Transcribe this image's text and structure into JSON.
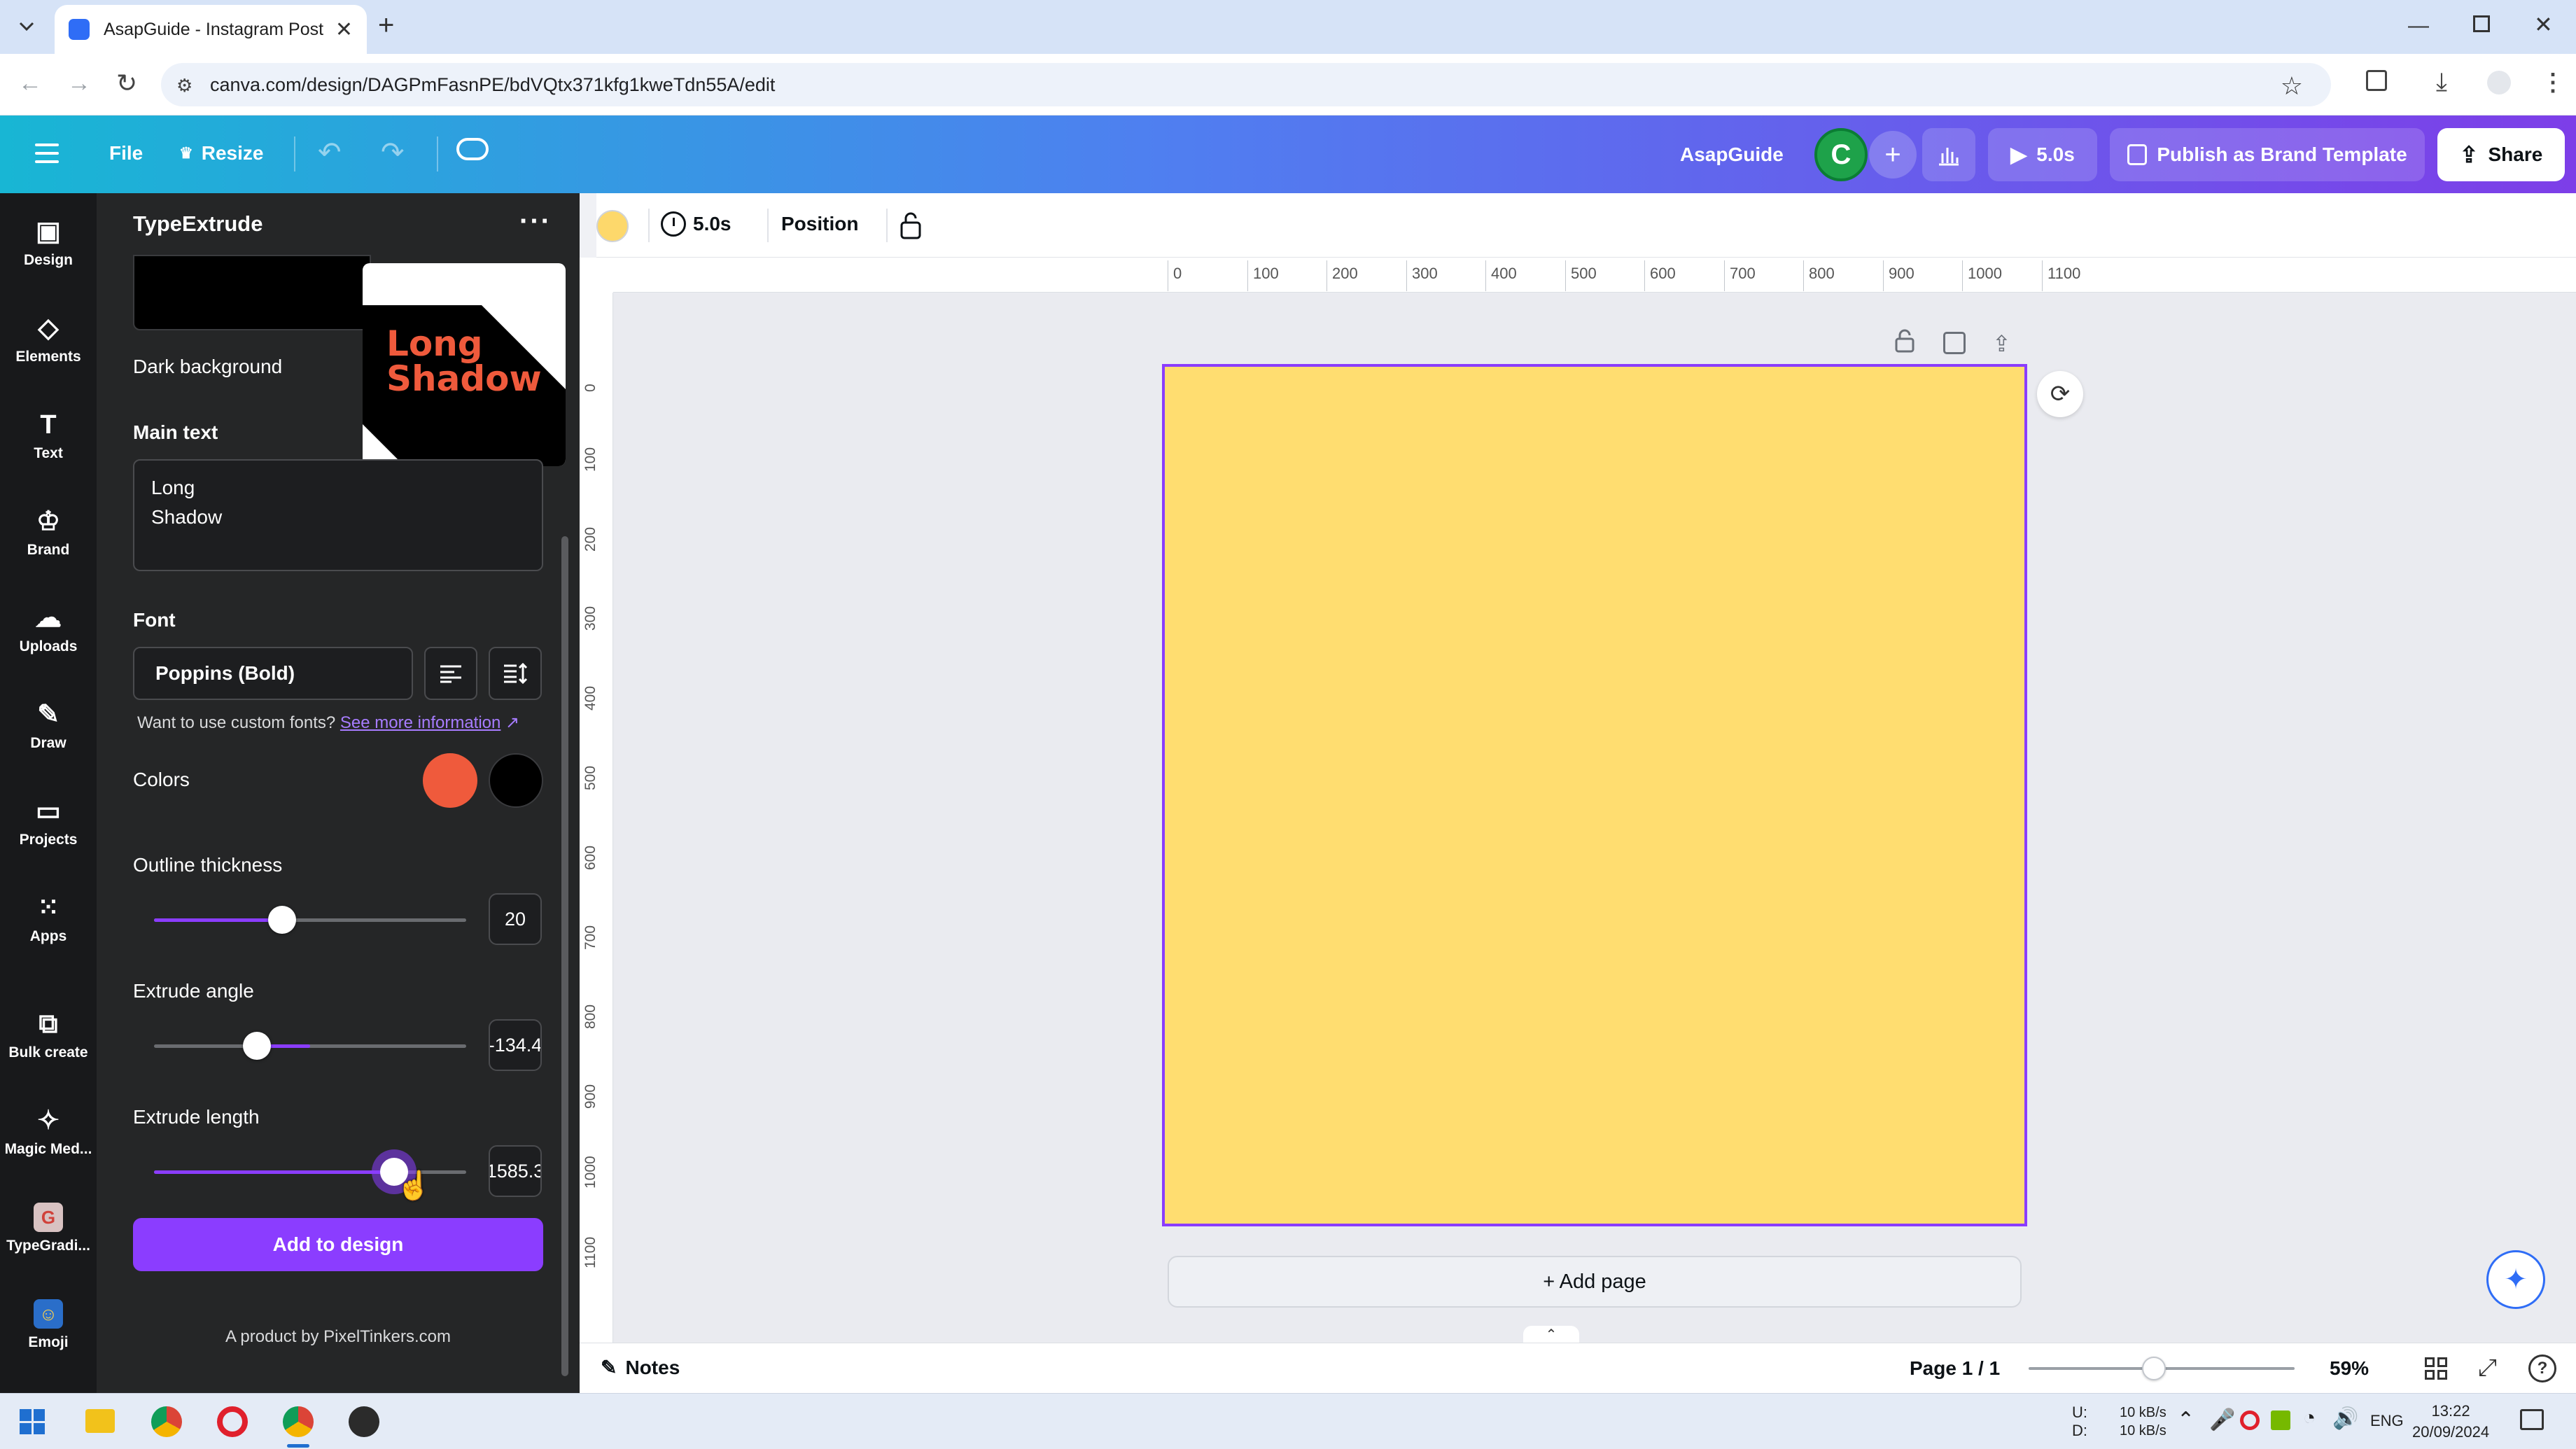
{
  "browser": {
    "tab_title": "AsapGuide - Instagram Post",
    "url": "canva.com/design/DAGPmFasnPE/bdVQtx371kfg1kweTdn55A/edit"
  },
  "header": {
    "file": "File",
    "resize": "Resize",
    "team": "AsapGuide",
    "avatar": "C",
    "duration": "5.0s",
    "publish": "Publish as Brand Template",
    "share": "Share"
  },
  "rail": [
    {
      "label": "Design",
      "icon": "design-icon"
    },
    {
      "label": "Elements",
      "icon": "elements-icon"
    },
    {
      "label": "Text",
      "icon": "text-icon"
    },
    {
      "label": "Brand",
      "icon": "brand-icon"
    },
    {
      "label": "Uploads",
      "icon": "uploads-icon"
    },
    {
      "label": "Draw",
      "icon": "draw-icon"
    },
    {
      "label": "Projects",
      "icon": "projects-icon"
    },
    {
      "label": "Apps",
      "icon": "apps-icon"
    },
    {
      "label": "Bulk create",
      "icon": "bulk-create-icon"
    },
    {
      "label": "Magic Med...",
      "icon": "magic-media-icon"
    },
    {
      "label": "TypeGradi...",
      "icon": "typegradient-icon"
    },
    {
      "label": "Emoji",
      "icon": "emoji-icon"
    }
  ],
  "panel": {
    "title": "TypeExtrude",
    "preset_label": "Dark background",
    "preview_text_1": "Long",
    "preview_text_2": "Shadow",
    "main_text_label": "Main text",
    "main_text_line1": "Long",
    "main_text_line2": "Shadow",
    "font_label": "Font",
    "font_value": "Poppins (Bold)",
    "custom_font_note": "Want to use custom fonts?",
    "custom_font_link": "See more information",
    "colors_label": "Colors",
    "color_1": "#ef5a3c",
    "color_2": "#000000",
    "outline_label": "Outline thickness",
    "outline_value": "20",
    "outline_level": 0.41,
    "angle_label": "Extrude angle",
    "angle_value": "-134.4",
    "angle_level": 0.33,
    "length_label": "Extrude length",
    "length_value": "1585.3",
    "length_level": 0.77,
    "add_button": "Add to design",
    "credit": "A product by PixelTinkers.com"
  },
  "toolbar": {
    "color": "#fdd86b",
    "duration": "5.0s",
    "position": "Position"
  },
  "ruler_h": [
    "0",
    "100",
    "200",
    "300",
    "400",
    "500",
    "600",
    "700",
    "800",
    "900",
    "1000",
    "1100"
  ],
  "ruler_v": [
    "0",
    "100",
    "200",
    "300",
    "400",
    "500",
    "600",
    "700",
    "800",
    "900",
    "1000",
    "1100"
  ],
  "canvas": {
    "page_color": "#ffdd70",
    "add_page": "+ Add page"
  },
  "footer": {
    "notes": "Notes",
    "page": "Page 1 / 1",
    "zoom": "59%",
    "zoom_level": 0.47
  },
  "taskbar": {
    "net_up_label": "U:",
    "net_down_label": "D:",
    "net_up": "10 kB/s",
    "net_down": "10 kB/s",
    "lang": "ENG",
    "time": "13:22",
    "date": "20/09/2024"
  }
}
